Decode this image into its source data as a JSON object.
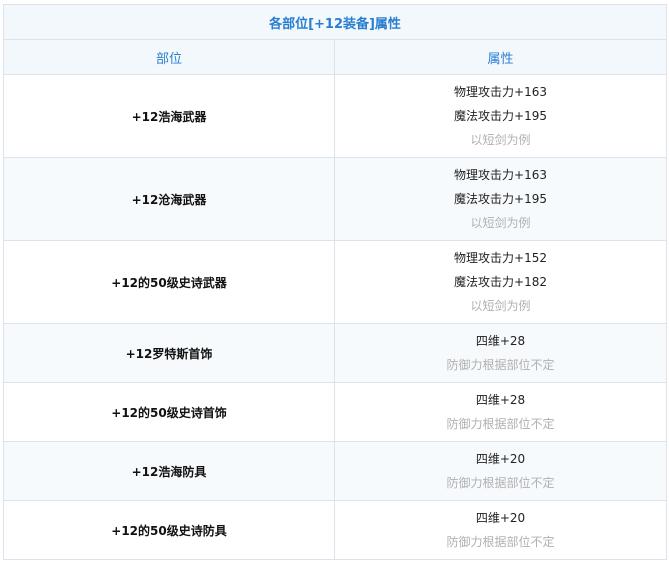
{
  "table": {
    "title": "各部位[+12装备]属性",
    "headers": [
      "部位",
      "属性"
    ],
    "rows": [
      {
        "part": "+12浩海武器",
        "attrs": [
          "物理攻击力+163",
          "魔法攻击力+195"
        ],
        "note": "以短剑为例"
      },
      {
        "part": "+12沧海武器",
        "attrs": [
          "物理攻击力+163",
          "魔法攻击力+195"
        ],
        "note": "以短剑为例"
      },
      {
        "part": "+12的50级史诗武器",
        "attrs": [
          "物理攻击力+152",
          "魔法攻击力+182"
        ],
        "note": "以短剑为例"
      },
      {
        "part": "+12罗特斯首饰",
        "attrs": [
          "四维+28"
        ],
        "note": "防御力根据部位不定"
      },
      {
        "part": "+12的50级史诗首饰",
        "attrs": [
          "四维+28"
        ],
        "note": "防御力根据部位不定"
      },
      {
        "part": "+12浩海防具",
        "attrs": [
          "四维+20"
        ],
        "note": "防御力根据部位不定"
      },
      {
        "part": "+12的50级史诗防具",
        "attrs": [
          "四维+20"
        ],
        "note": "防御力根据部位不定"
      }
    ]
  },
  "colors": {
    "header_text": "#2a7ed1",
    "header_bg": "#f3f8fd",
    "note_text": "#b0b0b0",
    "border": "#dde3ea"
  }
}
